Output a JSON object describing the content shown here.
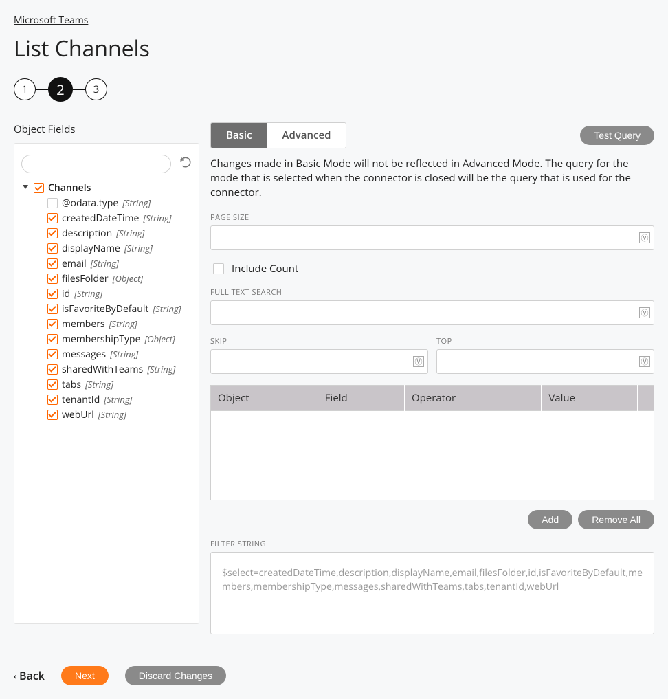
{
  "breadcrumb": {
    "parent": "Microsoft Teams"
  },
  "page": {
    "title": "List Channels"
  },
  "stepper": {
    "steps": [
      "1",
      "2",
      "3"
    ],
    "active": 1
  },
  "left": {
    "heading": "Object Fields",
    "search_placeholder": "",
    "root": {
      "label": "Channels"
    },
    "fields": [
      {
        "name": "@odata.type",
        "type": "[String]",
        "checked": false
      },
      {
        "name": "createdDateTime",
        "type": "[String]",
        "checked": true
      },
      {
        "name": "description",
        "type": "[String]",
        "checked": true
      },
      {
        "name": "displayName",
        "type": "[String]",
        "checked": true
      },
      {
        "name": "email",
        "type": "[String]",
        "checked": true
      },
      {
        "name": "filesFolder",
        "type": "[Object]",
        "checked": true
      },
      {
        "name": "id",
        "type": "[String]",
        "checked": true
      },
      {
        "name": "isFavoriteByDefault",
        "type": "[String]",
        "checked": true
      },
      {
        "name": "members",
        "type": "[String]",
        "checked": true
      },
      {
        "name": "membershipType",
        "type": "[Object]",
        "checked": true
      },
      {
        "name": "messages",
        "type": "[String]",
        "checked": true
      },
      {
        "name": "sharedWithTeams",
        "type": "[String]",
        "checked": true
      },
      {
        "name": "tabs",
        "type": "[String]",
        "checked": true
      },
      {
        "name": "tenantId",
        "type": "[String]",
        "checked": true
      },
      {
        "name": "webUrl",
        "type": "[String]",
        "checked": true
      }
    ]
  },
  "right": {
    "tabs": {
      "basic": "Basic",
      "advanced": "Advanced"
    },
    "test_query": "Test Query",
    "help": "Changes made in Basic Mode will not be reflected in Advanced Mode. The query for the mode that is selected when the connector is closed will be the query that is used for the connector.",
    "page_size_label": "PAGE SIZE",
    "page_size_value": "",
    "include_count_label": "Include Count",
    "full_text_label": "FULL TEXT SEARCH",
    "full_text_value": "",
    "skip_label": "SKIP",
    "skip_value": "",
    "top_label": "TOP",
    "top_value": "",
    "filter_table": {
      "headers": [
        "Object",
        "Field",
        "Operator",
        "Value"
      ]
    },
    "add": "Add",
    "remove_all": "Remove All",
    "filter_string_label": "FILTER STRING",
    "filter_string_value": "$select=createdDateTime,description,displayName,email,filesFolder,id,isFavoriteByDefault,members,membershipType,messages,sharedWithTeams,tabs,tenantId,webUrl"
  },
  "footer": {
    "back": "Back",
    "next": "Next",
    "discard": "Discard Changes"
  }
}
